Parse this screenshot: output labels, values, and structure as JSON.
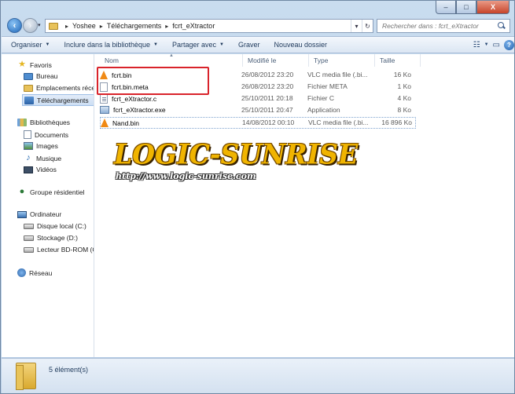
{
  "caption": {
    "minimize": "–",
    "maximize": "□",
    "close": "X"
  },
  "address": {
    "crumbs": [
      "Yoshee",
      "Téléchargements",
      "fcrt_eXtractor"
    ],
    "dropdown": "▾",
    "refresh": "↻"
  },
  "search": {
    "placeholder": "Rechercher dans : fcrt_eXtractor"
  },
  "toolbar": {
    "organize": "Organiser",
    "include": "Inclure dans la bibliothèque",
    "share": "Partager avec",
    "burn": "Graver",
    "new_folder": "Nouveau dossier",
    "help": "?"
  },
  "sidebar": {
    "favorites": "Favoris",
    "desktop": "Bureau",
    "recent": "Emplacements récents",
    "downloads": "Téléchargements",
    "libraries": "Bibliothèques",
    "documents": "Documents",
    "images": "Images",
    "music": "Musique",
    "videos": "Vidéos",
    "homegroup": "Groupe résidentiel",
    "computer": "Ordinateur",
    "drive_c": "Disque local (C:)",
    "drive_d": "Stockage (D:)",
    "drive_g": "Lecteur BD-ROM (G:)",
    "network": "Réseau"
  },
  "columns": {
    "name": "Nom",
    "modified": "Modifié le",
    "type": "Type",
    "size": "Taille"
  },
  "files": [
    {
      "name": "fcrt.bin",
      "modified": "26/08/2012 23:20",
      "type": "VLC media file (.bi...",
      "size": "16 Ko",
      "icon": "vlc-icon"
    },
    {
      "name": "fcrt.bin.meta",
      "modified": "26/08/2012 23:20",
      "type": "Fichier META",
      "size": "1 Ko",
      "icon": "file-icon"
    },
    {
      "name": "fcrt_eXtractor.c",
      "modified": "25/10/2011 20:18",
      "type": "Fichier C",
      "size": "4 Ko",
      "icon": "c-file-icon"
    },
    {
      "name": "fcrt_eXtractor.exe",
      "modified": "25/10/2011 20:47",
      "type": "Application",
      "size": "8 Ko",
      "icon": "exe-icon"
    },
    {
      "name": "Nand.bin",
      "modified": "14/08/2012 00:10",
      "type": "VLC media file (.bi...",
      "size": "16 896 Ko",
      "icon": "vlc-icon"
    }
  ],
  "watermark": {
    "title": "LOGIC-SUNRISE",
    "url": "http://www.logic-sunrise.com"
  },
  "status": {
    "count": "5 élément(s)"
  },
  "colors": {
    "highlight": "#d9232b",
    "watermark": "#f0b400"
  }
}
